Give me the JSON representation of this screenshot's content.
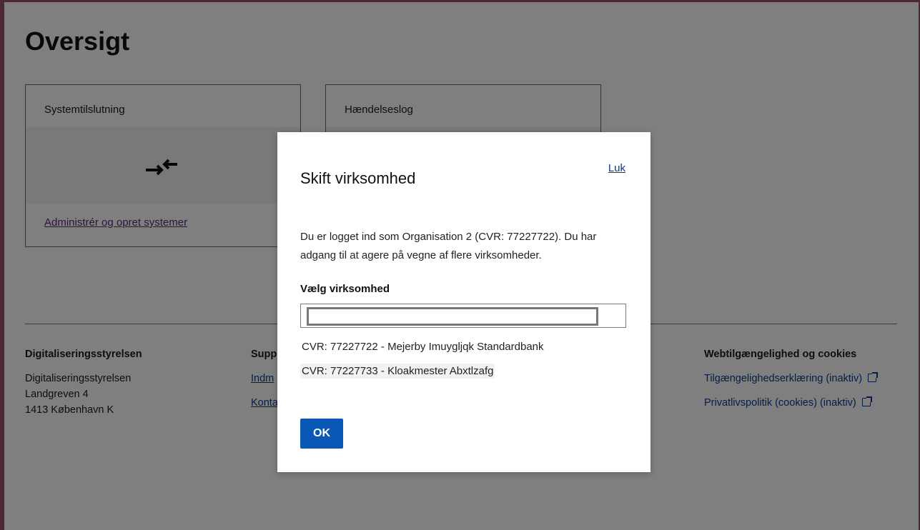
{
  "page": {
    "title": "Oversigt",
    "cards": [
      {
        "title": "Systemtilslutning",
        "link": "Administrér og opret systemer"
      },
      {
        "title": "Hændelseslog"
      }
    ]
  },
  "footer": {
    "col1": {
      "heading": "Digitaliseringsstyrelsen",
      "lines": [
        "Digitaliseringsstyrelsen",
        "Landgreven 4",
        "1413 København K"
      ]
    },
    "col2": {
      "heading": "Supp",
      "links": [
        "Indm",
        "Konta"
      ]
    },
    "col3": {
      "heading": "Webtilgængelighed og cookies",
      "links": [
        "Tilgængelighedserklæring (inaktiv)",
        "Privatlivspolitik (cookies) (inaktiv)"
      ]
    }
  },
  "modal": {
    "close_label": "Luk",
    "title": "Skift virksomhed",
    "intro": "Du er logget ind som Organisation 2 (CVR: 77227722). Du har adgang til at agere på vegne af flere virksomheder.",
    "field_label": "Vælg virksomhed",
    "input_value": "",
    "options": [
      "CVR: 77227722 - Mejerby Imuygljqk Standardbank",
      "CVR: 77227733 - Kloakmester Abxtlzafg"
    ],
    "ok_label": "OK"
  },
  "colors": {
    "primary": "#0a58b5",
    "link": "#0a3c8a",
    "frame": "#4a2a33"
  },
  "icons": {
    "card1": "arrows-in-icon",
    "external": "external-link-icon"
  }
}
